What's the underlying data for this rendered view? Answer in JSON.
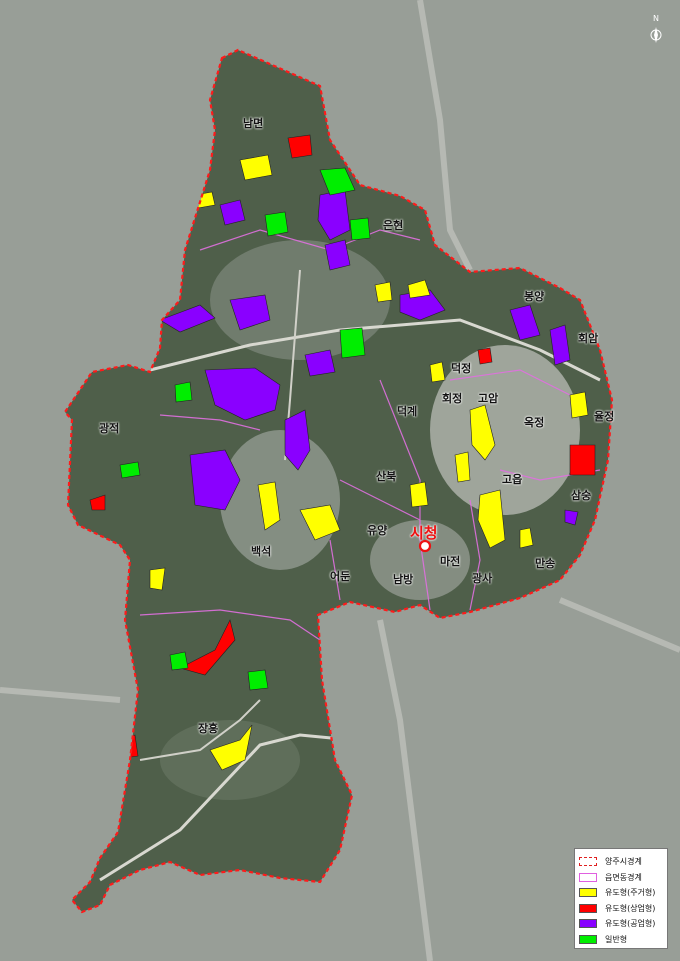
{
  "map": {
    "districts": [
      {
        "name": "남면"
      },
      {
        "name": "은현"
      },
      {
        "name": "봉양"
      },
      {
        "name": "회암"
      },
      {
        "name": "덕정"
      },
      {
        "name": "회정"
      },
      {
        "name": "고암"
      },
      {
        "name": "율정"
      },
      {
        "name": "광적"
      },
      {
        "name": "덕계"
      },
      {
        "name": "옥정"
      },
      {
        "name": "산북"
      },
      {
        "name": "고읍"
      },
      {
        "name": "삼숭"
      },
      {
        "name": "유양"
      },
      {
        "name": "백석"
      },
      {
        "name": "마전"
      },
      {
        "name": "만송"
      },
      {
        "name": "어둔"
      },
      {
        "name": "남방"
      },
      {
        "name": "광사"
      },
      {
        "name": "장흥"
      }
    ],
    "city_hall_label": "시청",
    "north_label": "N"
  },
  "legend": {
    "items": [
      {
        "label": "양주시경계",
        "color": "#e02020",
        "style": "dashed"
      },
      {
        "label": "읍면동경계",
        "color": "#e060e0",
        "style": "outline"
      },
      {
        "label": "유도형(주거형)",
        "color": "#ffff00",
        "style": "fill"
      },
      {
        "label": "유도형(상업형)",
        "color": "#ff0000",
        "style": "fill"
      },
      {
        "label": "유도형(공업형)",
        "color": "#8800ff",
        "style": "fill"
      },
      {
        "label": "일반형",
        "color": "#00ee00",
        "style": "fill"
      }
    ]
  }
}
